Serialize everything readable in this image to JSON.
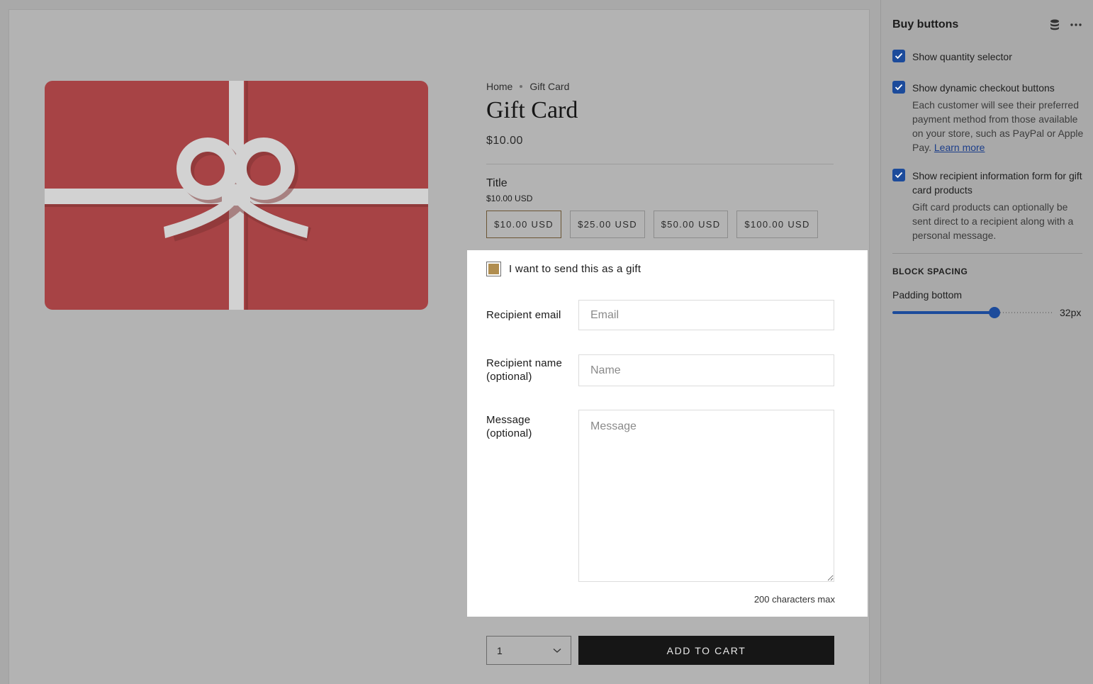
{
  "product": {
    "breadcrumb": [
      "Home",
      "Gift Card"
    ],
    "title": "Gift Card",
    "price": "$10.00",
    "option_label": "Title",
    "option_value": "$10.00 USD",
    "variants": [
      "$10.00 USD",
      "$25.00 USD",
      "$50.00 USD",
      "$100.00 USD"
    ],
    "selected_variant": "$10.00 USD"
  },
  "gift_form": {
    "send_as_gift_label": "I want to send this as a gift",
    "send_as_gift_checked": true,
    "email_label": "Recipient email",
    "email_placeholder": "Email",
    "name_label_line1": "Recipient name",
    "name_label_line2": "(optional)",
    "name_placeholder": "Name",
    "message_label_line1": "Message",
    "message_label_line2": "(optional)",
    "message_placeholder": "Message",
    "char_limit_note": "200 characters max"
  },
  "cart": {
    "quantity": "1",
    "add_to_cart_label": "ADD TO CART"
  },
  "sidebar": {
    "title": "Buy buttons",
    "options": [
      {
        "label": "Show quantity selector",
        "checked": true
      },
      {
        "label": "Show dynamic checkout buttons",
        "checked": true,
        "help": "Each customer will see their preferred payment method from those available on your store, such as PayPal or Apple Pay.",
        "help_link": "Learn more"
      },
      {
        "label": "Show recipient information form for gift card products",
        "checked": true,
        "help": "Gift card products can optionally be sent direct to a recipient along with a personal message."
      }
    ],
    "section_heading": "BLOCK SPACING",
    "padding_label": "Padding bottom",
    "padding_value": "32px",
    "padding_fraction": 0.63
  },
  "colors": {
    "card_red": "#a74345",
    "ribbon": "#d4d4d4",
    "accent_blue": "#1c4b9b",
    "gift_checkbox_fill": "#b08d4f",
    "button_dark": "#161616"
  }
}
